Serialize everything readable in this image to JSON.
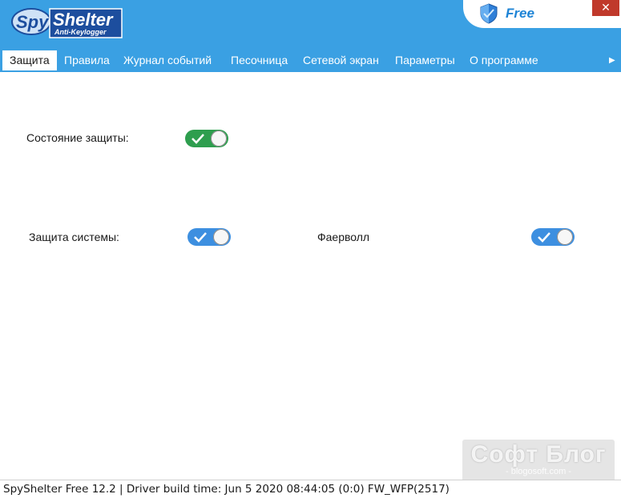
{
  "app": {
    "logo_text_main": "Shelter",
    "logo_text_prefix": "Spy",
    "logo_subtitle": "Anti-Keylogger",
    "edition": "Free",
    "close_glyph": "✕"
  },
  "tabs": [
    {
      "label": "Защита",
      "active": true
    },
    {
      "label": "Правила",
      "active": false
    },
    {
      "label": "Журнал событий",
      "active": false
    },
    {
      "label": "Песочница",
      "active": false
    },
    {
      "label": "Сетевой экран",
      "active": false
    },
    {
      "label": "Параметры",
      "active": false
    },
    {
      "label": "О программе",
      "active": false
    }
  ],
  "scroll_arrow": "▶",
  "protection": {
    "status_label": "Состояние защиты:",
    "status_on": true,
    "status_color": "#2e9e4e",
    "system_label": "Защита системы:",
    "system_on": true,
    "firewall_label": "Фаерволл",
    "firewall_on": true,
    "toggle_color": "#3d8fe0"
  },
  "statusbar": {
    "text": "SpyShelter Free 12.2  |  Driver build time: Jun  5 2020 08:44:05  (0:0) FW_WFP(2517)"
  },
  "watermark": {
    "title": "Софт Блог",
    "subtitle": "- blogosoft.com -"
  },
  "colors": {
    "titlebar": "#3aa0e3",
    "accent_text": "#1e84d6",
    "logo_dark": "#1d4e9e"
  },
  "icons": {
    "shield": "shield-icon",
    "check": "checkmark-icon",
    "close": "close-icon"
  }
}
